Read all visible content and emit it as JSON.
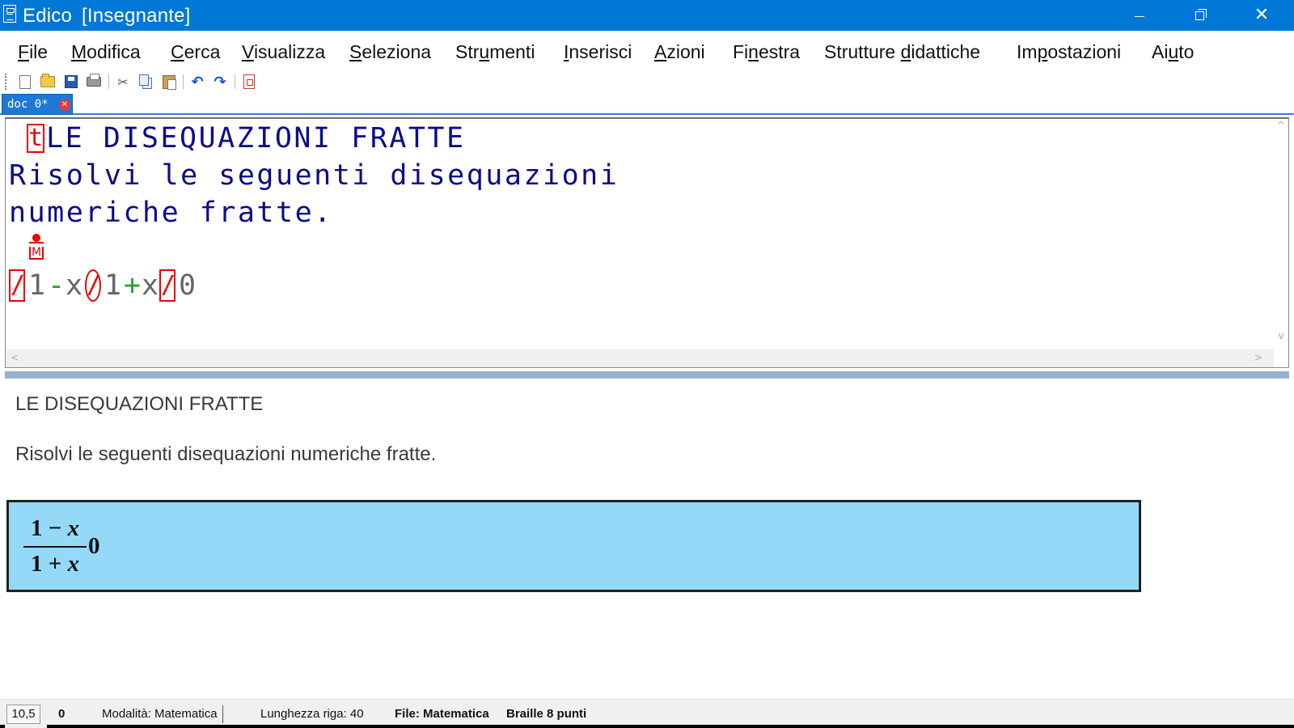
{
  "window": {
    "app_name": "Edico",
    "mode": "[Insegnante]",
    "accent_color": "#0078d7",
    "controls": {
      "minimize_icon": "minimize-icon",
      "maximize_icon": "restore-icon",
      "close_icon": "close-icon",
      "close_glyph": "✕"
    }
  },
  "menu": {
    "items": [
      {
        "label": "File",
        "underline": "F"
      },
      {
        "label": "Modifica",
        "underline": "M"
      },
      {
        "label": "Cerca",
        "underline": "C"
      },
      {
        "label": "Visualizza",
        "underline": "V"
      },
      {
        "label": "Seleziona",
        "underline": "S"
      },
      {
        "label": "Strumenti",
        "underline": "u"
      },
      {
        "label": "Inserisci",
        "underline": "I"
      },
      {
        "label": "Azioni",
        "underline": "A"
      },
      {
        "label": "Finestra",
        "underline": "n"
      },
      {
        "label": "Strutture didattiche",
        "underline": "d"
      },
      {
        "label": "Impostazioni",
        "underline": "p"
      },
      {
        "label": "Aiuto",
        "underline": "u"
      }
    ]
  },
  "toolbar": {
    "buttons": [
      "new-document-icon",
      "open-folder-icon",
      "save-icon",
      "print-icon",
      "cut-icon",
      "copy-icon",
      "paste-icon",
      "undo-icon",
      "redo-icon",
      "export-pdf-icon"
    ],
    "glyphs": {
      "cut": "✂",
      "undo": "↶",
      "redo": "↷"
    }
  },
  "tab": {
    "label": "doc 0*",
    "close_glyph": "✕",
    "color": "#1e78d6"
  },
  "editor": {
    "title_marker": "t",
    "line1": "LE DISEQUAZIONI FRATTE",
    "line2": "Risolvi le seguenti disequazioni",
    "line3": "numeriche fratte.",
    "math_marker": "M",
    "math_tokens": [
      "/",
      "1",
      "-",
      "x",
      "/",
      "1",
      "+",
      "x",
      "/",
      "0"
    ],
    "text_color": "#0c0c8a",
    "marker_color": "#ee0000",
    "scroll": {
      "up": "^",
      "down": "v",
      "left": "<",
      "right": ">"
    }
  },
  "preview": {
    "title": "LE DISEQUAZIONI FRATTE",
    "text": "Risolvi le seguenti disequazioni numeriche fratte.",
    "math": {
      "numerator_a": "1 − ",
      "numerator_var": "x",
      "denominator_a": "1 + ",
      "denominator_var": "x",
      "tail": "0"
    },
    "math_box_color": "#95d9f9"
  },
  "status": {
    "position": "10,5",
    "count": "0",
    "mode": "Modalità: Matematica",
    "line_length": "Lunghezza riga: 40",
    "file": "File: Matematica",
    "braille": "Braille 8 punti"
  }
}
